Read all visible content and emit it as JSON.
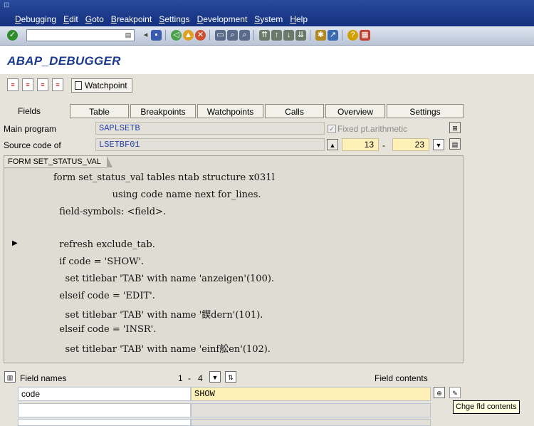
{
  "menubar": {
    "items": [
      "Debugging",
      "Edit",
      "Goto",
      "Breakpoint",
      "Settings",
      "Development",
      "System",
      "Help"
    ]
  },
  "toolbar": {
    "command_value": "",
    "icons": [
      "enter-icon",
      "save-icon",
      "back-icon",
      "exit-icon",
      "cancel-icon",
      "print-icon",
      "find-icon",
      "find-next-icon",
      "first-page-icon",
      "previous-page-icon",
      "next-page-icon",
      "last-page-icon",
      "new-session-icon",
      "shortcut-icon",
      "help-icon",
      "layout-icon"
    ]
  },
  "title": "ABAP_DEBUGGER",
  "app_toolbar": {
    "watchpoint_label": "Watchpoint"
  },
  "tabs": [
    {
      "label": "Fields",
      "active": true
    },
    {
      "label": "Table"
    },
    {
      "label": "Breakpoints"
    },
    {
      "label": "Watchpoints"
    },
    {
      "label": "Calls"
    },
    {
      "label": "Overview"
    },
    {
      "label": "Settings"
    }
  ],
  "main_program": {
    "label": "Main program",
    "value": "SAPLSETB"
  },
  "fixed_pt": {
    "label": "Fixed pt.arithmetic",
    "checked": true
  },
  "source": {
    "label": "Source code of",
    "value": "LSETBF01",
    "line_from": "13",
    "separator": "-",
    "line_to": "23"
  },
  "code_panel": {
    "tab_label": "FORM SET_STATUS_VAL",
    "lines": [
      "form set_status_val tables ntab structure x031l",
      "                    using code name next for_lines.",
      "  field-symbols: <field>.",
      "",
      "  refresh exclude_tab.",
      "  if code = 'SHOW'.",
      "    set titlebar 'TAB' with name 'anzeigen'(100).",
      "  elseif code = 'EDIT'.",
      "    set titlebar 'TAB' with name '鍥dern'(101).",
      "  elseif code = 'INSR'.",
      "    set titlebar 'TAB' with name 'einf舩en'(102)."
    ]
  },
  "fields": {
    "names_label": "Field names",
    "range_from": "1",
    "range_sep": "-",
    "range_to": "4",
    "contents_label": "Field contents",
    "rows": [
      {
        "name": "code",
        "value": "SHOW"
      },
      {
        "name": "",
        "value": ""
      },
      {
        "name": "",
        "value": ""
      }
    ]
  },
  "tooltip": "Chge fld contents",
  "colors": {
    "menubar": "#1e3c8c",
    "title": "#1c3a8f",
    "highlight": "#fff0b8"
  }
}
